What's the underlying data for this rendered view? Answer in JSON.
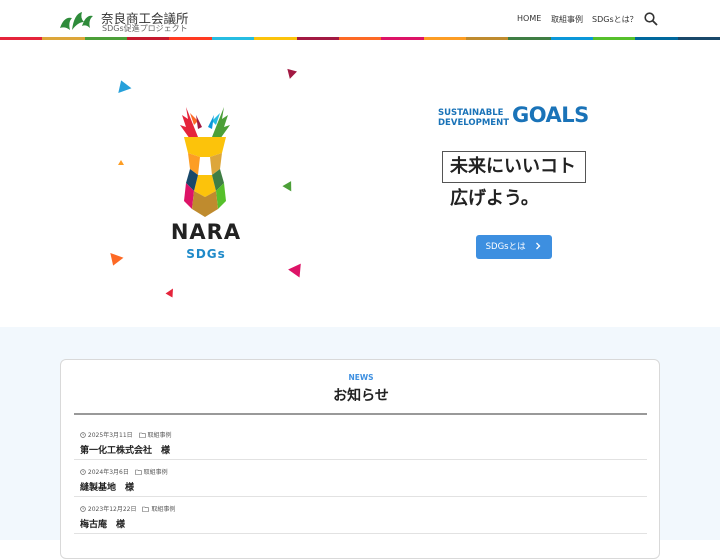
{
  "header": {
    "site_title": "奈良商工会議所",
    "site_subtitle": "SDGs促進プロジェクト",
    "nav": [
      "HOME",
      "取組事例",
      "SDGsとは？"
    ],
    "search_icon": "search-icon"
  },
  "sdg_colors": [
    "#e5243b",
    "#dda63a",
    "#4c9f38",
    "#c5192d",
    "#ff3a21",
    "#26bde2",
    "#fcc30b",
    "#a21942",
    "#fd6925",
    "#dd1367",
    "#fd9d24",
    "#bf8b2e",
    "#3f7e44",
    "#0a97d9",
    "#56c02b",
    "#00689d",
    "#19486a"
  ],
  "hero": {
    "logo_text": "NARA",
    "logo_sub": "SDGs",
    "goals_line1": "SUSTAINABLE",
    "goals_line2": "DEVELOPMENT",
    "goals_word": "GOALS",
    "tagline_line1": "未来にいいコト",
    "tagline_line2": "広げよう。",
    "cta_label": "SDGsとは",
    "cta_icon": "chevron-right-icon"
  },
  "news": {
    "label": "NEWS",
    "title": "お知らせ",
    "items": [
      {
        "date": "2025年3月11日",
        "category": "取組事例",
        "title": "第一化工株式会社　様"
      },
      {
        "date": "2024年3月6日",
        "category": "取組事例",
        "title": "縫製基地　様"
      },
      {
        "date": "2023年12月22日",
        "category": "取組事例",
        "title": "梅古庵　様"
      }
    ]
  }
}
